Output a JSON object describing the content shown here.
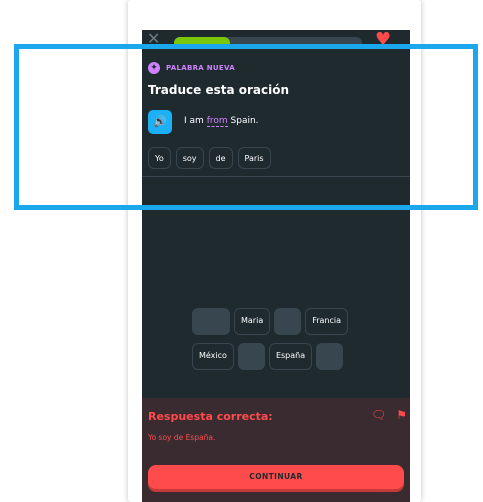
{
  "topbar": {
    "close_icon": "close-icon",
    "progress_fraction": 0.3,
    "heart_icon": "heart-icon"
  },
  "lesson": {
    "badge": "PALABRA NUEVA",
    "title": "Traduce esta oración",
    "prompt_before": "I am",
    "prompt_highlight": "from",
    "prompt_after": "Spain.",
    "speaker_icon": "speaker-icon"
  },
  "answer_words": [
    "Yo",
    "soy",
    "de",
    "Paris"
  ],
  "word_bank": {
    "row1": [
      {
        "type": "empty"
      },
      {
        "type": "word",
        "label": "Maria"
      },
      {
        "type": "empty"
      },
      {
        "type": "word",
        "label": "Francia"
      }
    ],
    "row2": [
      {
        "type": "word",
        "label": "México"
      },
      {
        "type": "empty"
      },
      {
        "type": "word",
        "label": "España"
      },
      {
        "type": "empty"
      }
    ]
  },
  "feedback": {
    "title": "Respuesta correcta:",
    "text": "Yo soy de España.",
    "continue_label": "CONTINUAR"
  },
  "colors": {
    "background": "#1f2a2f",
    "accent_blue": "#1cb0f6",
    "error_red": "#ff4b4b",
    "new_word_purple": "#ce82ff"
  }
}
